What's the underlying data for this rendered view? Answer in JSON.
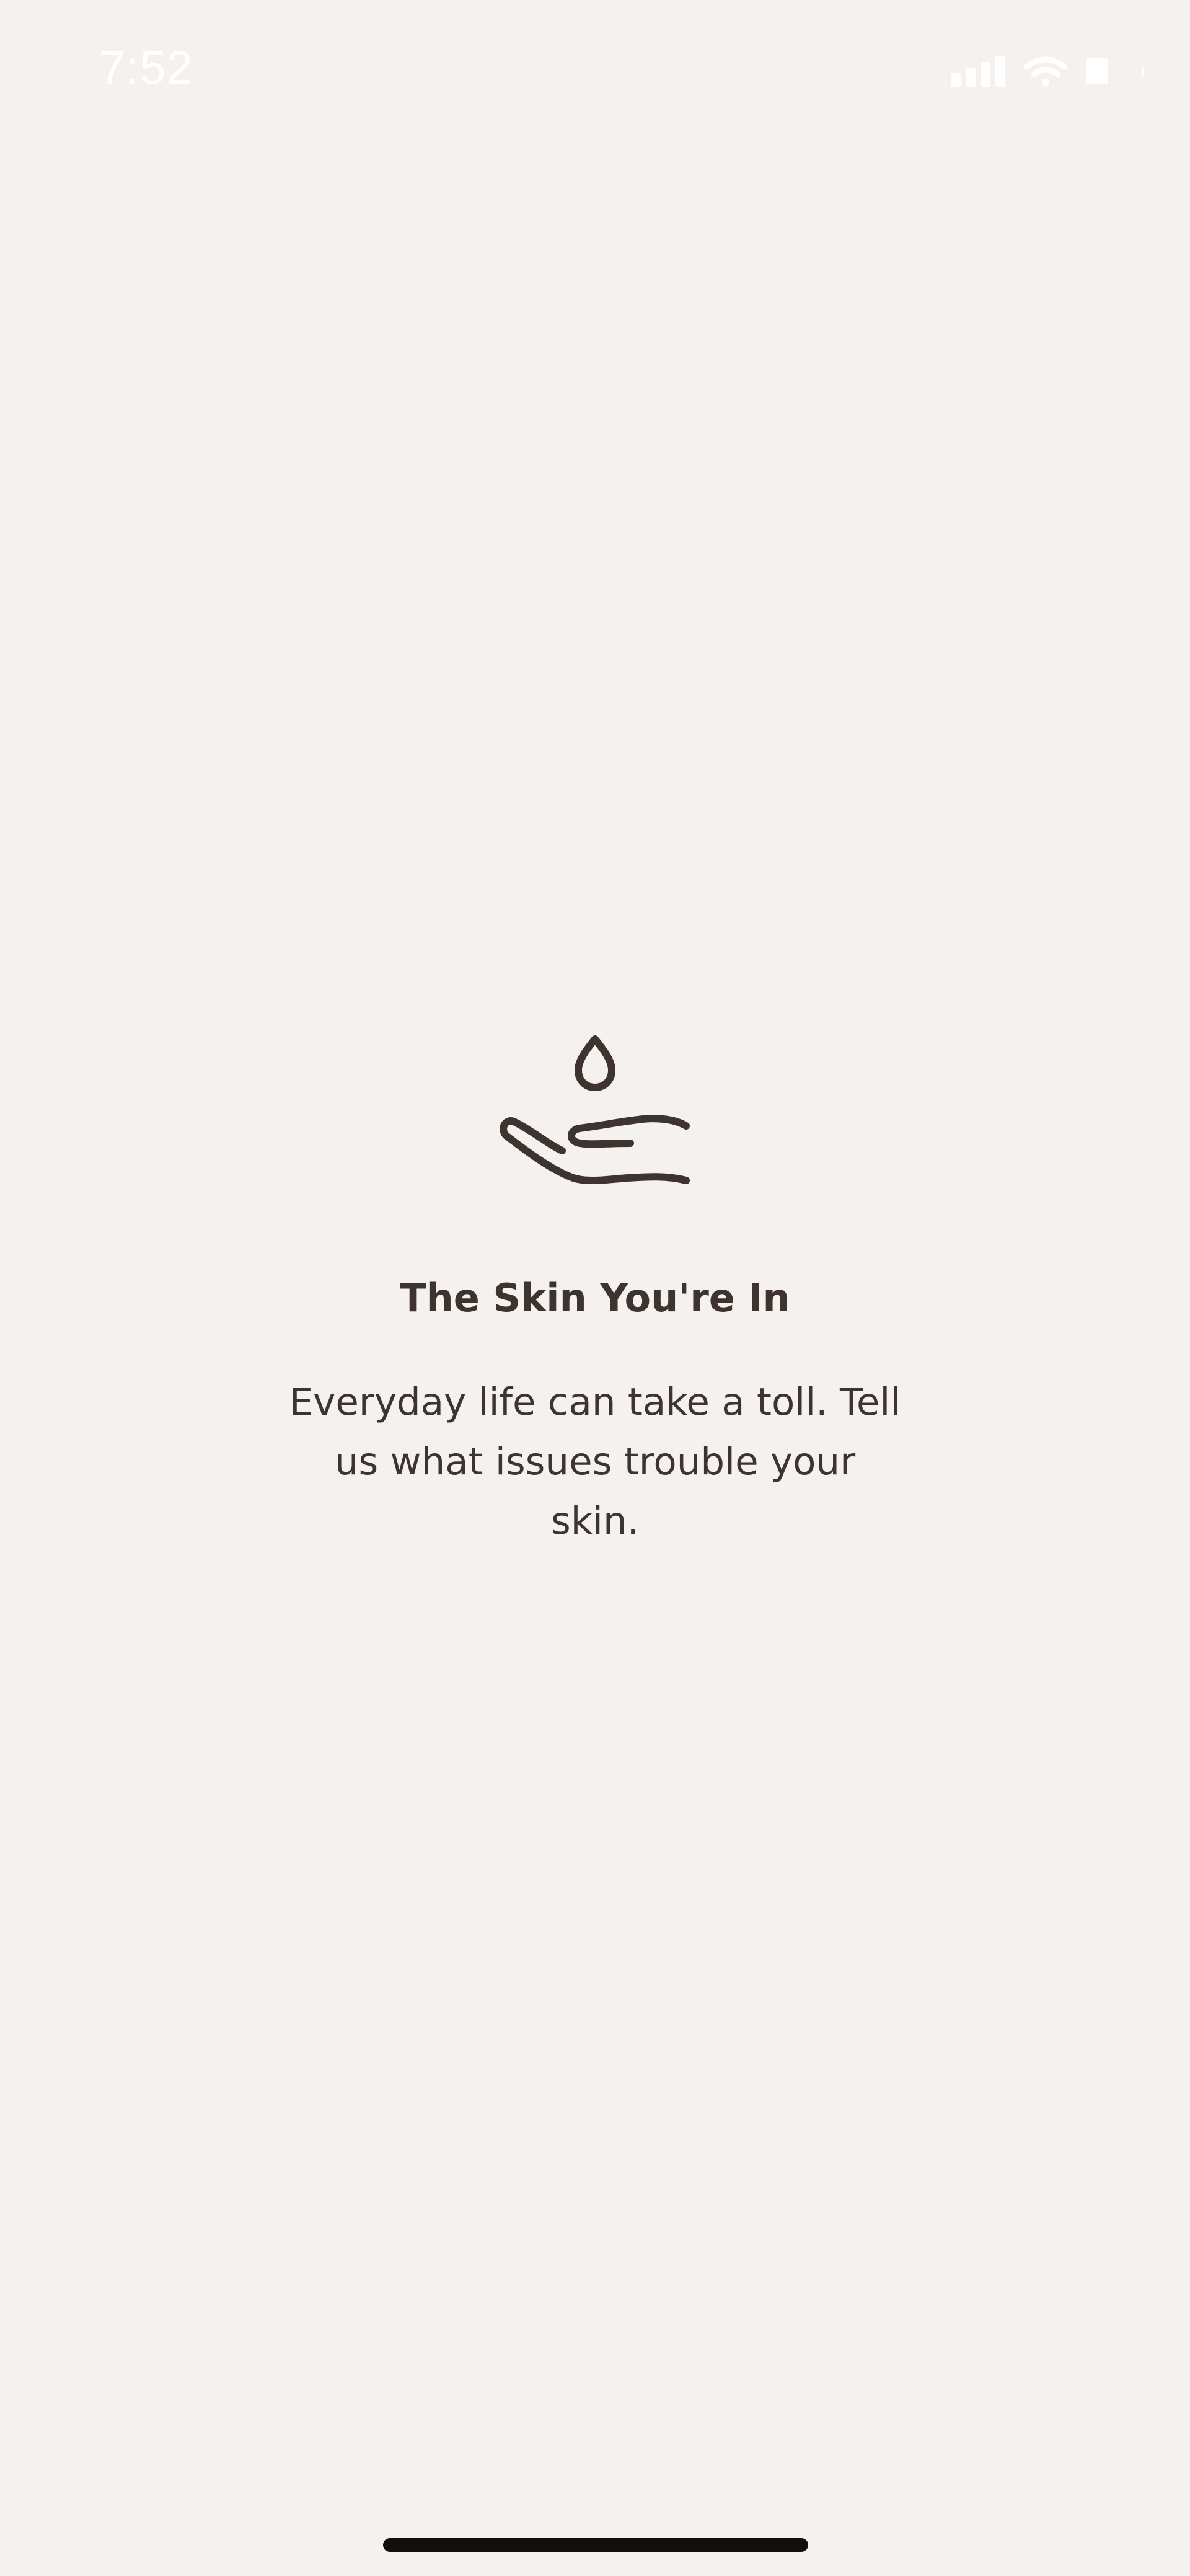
{
  "status_bar": {
    "time": "7:52",
    "icons": [
      "signal-icon",
      "wifi-icon",
      "battery-icon"
    ]
  },
  "screen": {
    "icon": "hand-with-drop-icon",
    "title": "The Skin You're In",
    "description": "Everyday life can take a toll. Tell us what issues trouble your skin."
  },
  "colors": {
    "background": "#f4f1ef",
    "text": "#3d3430",
    "status_text": "#ffffff"
  }
}
